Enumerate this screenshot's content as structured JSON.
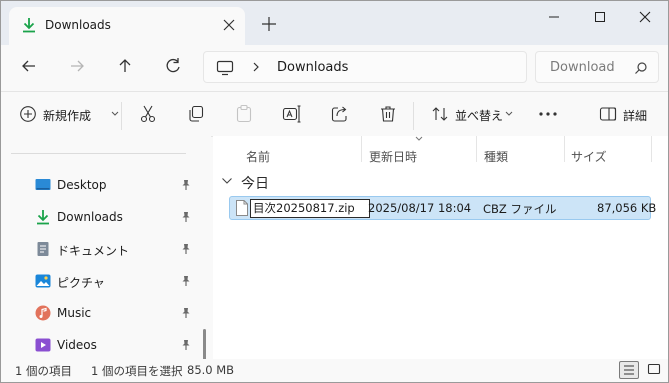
{
  "tab": {
    "title": "Downloads",
    "icon": "download-icon"
  },
  "window_controls": {
    "minimize": "minimize-icon",
    "maximize": "maximize-icon",
    "close": "close-icon"
  },
  "address": {
    "crumbs": [
      "Downloads"
    ],
    "root_icon": "pc-icon"
  },
  "search": {
    "placeholder": "Download"
  },
  "commands": {
    "new_label": "新規作成",
    "sort_label": "並べ替え",
    "details_label": "詳細"
  },
  "sidebar": {
    "items": [
      {
        "label": "Desktop",
        "icon": "desktop-icon"
      },
      {
        "label": "Downloads",
        "icon": "download-icon"
      },
      {
        "label": "ドキュメント",
        "icon": "documents-icon"
      },
      {
        "label": "ピクチャ",
        "icon": "pictures-icon"
      },
      {
        "label": "Music",
        "icon": "music-icon"
      },
      {
        "label": "Videos",
        "icon": "videos-icon"
      }
    ]
  },
  "columns": {
    "name": "名前",
    "modified": "更新日時",
    "type": "種類",
    "size": "サイズ"
  },
  "group": {
    "label": "今日"
  },
  "files": [
    {
      "name": "目次20250817.zip",
      "modified": "2025/08/17 18:04",
      "type": "CBZ ファイル",
      "size": "87,056 KB"
    }
  ],
  "status": {
    "count": "1 個の項目",
    "selected": "1 個の項目を選択",
    "size": "85.0 MB"
  },
  "colors": {
    "accent": "#0067c0",
    "selection": "#cce4f7",
    "download_green": "#1aa34a"
  }
}
